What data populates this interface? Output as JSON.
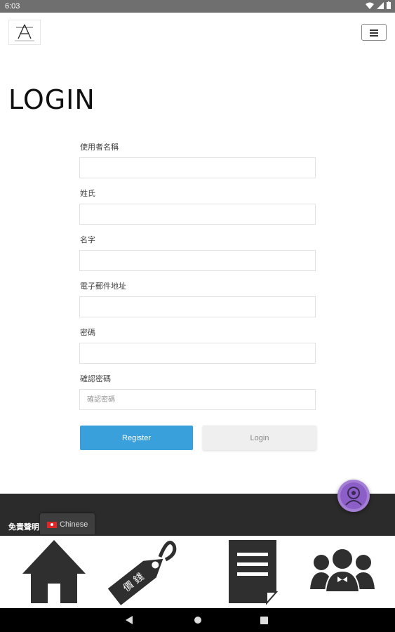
{
  "status_bar": {
    "time": "6:03"
  },
  "header": {
    "menu_button": "menu"
  },
  "page": {
    "title": "LOGIN"
  },
  "form": {
    "fields": [
      {
        "label": "使用者名稱",
        "value": "",
        "placeholder": ""
      },
      {
        "label": "姓氏",
        "value": "",
        "placeholder": ""
      },
      {
        "label": "名字",
        "value": "",
        "placeholder": ""
      },
      {
        "label": "電子郵件地址",
        "value": "",
        "placeholder": ""
      },
      {
        "label": "密碼",
        "value": "",
        "placeholder": ""
      },
      {
        "label": "確認密碼",
        "value": "",
        "placeholder": "確認密碼"
      }
    ],
    "register_label": "Register",
    "login_label": "Login"
  },
  "footer": {
    "disclaimer": "免責聲明",
    "language": "Chinese"
  },
  "bottom_nav": [
    {
      "icon": "home-icon"
    },
    {
      "icon": "price-tag-icon",
      "tag_text": "價 錢"
    },
    {
      "icon": "document-icon"
    },
    {
      "icon": "people-icon"
    }
  ],
  "colors": {
    "primary": "#3aa0dc",
    "footer": "#2b2b2b",
    "chat": "#a57fd6"
  }
}
